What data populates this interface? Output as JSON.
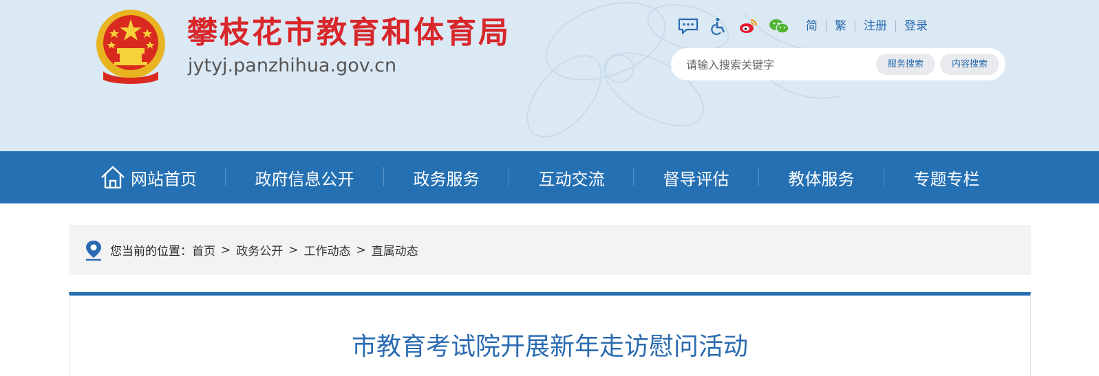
{
  "header": {
    "site_title": "攀枝花市教育和体育局",
    "site_domain": "jytyj.panzhihua.gov.cn",
    "toplinks": {
      "icons": [
        "message-icon",
        "accessibility-icon",
        "weibo-icon",
        "wechat-icon"
      ],
      "simplified": "简",
      "traditional": "繁",
      "register": "注册",
      "login": "登录"
    },
    "search": {
      "placeholder": "请输入搜索关键字",
      "service_button": "服务搜索",
      "content_button": "内容搜索"
    }
  },
  "nav": {
    "items": [
      {
        "label": "网站首页",
        "icon": "home-icon"
      },
      {
        "label": "政府信息公开"
      },
      {
        "label": "政务服务"
      },
      {
        "label": "互动交流"
      },
      {
        "label": "督导评估"
      },
      {
        "label": "教体服务"
      },
      {
        "label": "专题专栏"
      }
    ]
  },
  "breadcrumb": {
    "label": "您当前的位置：",
    "items": [
      "首页",
      "政务公开",
      "工作动态",
      "直属动态"
    ],
    "separator": ">"
  },
  "article": {
    "title": "市教育考试院开展新年走访慰问活动"
  },
  "colors": {
    "nav_bg": "#2470b3",
    "header_bg": "#dbe9f4",
    "title_red": "#d8262a",
    "link_blue": "#2a6bb0"
  }
}
